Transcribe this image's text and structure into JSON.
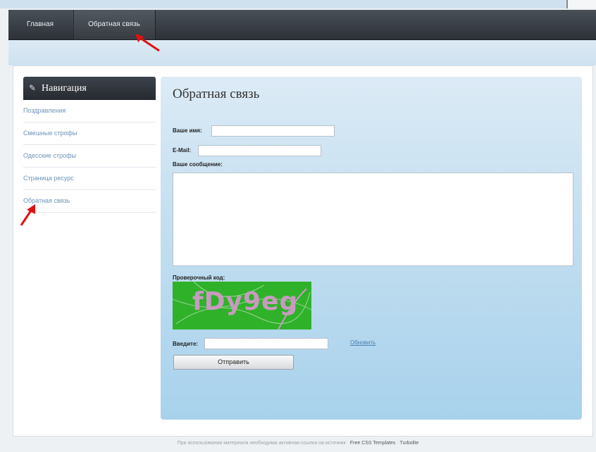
{
  "nav": {
    "home": "Главная",
    "feedback": "Обратная связь"
  },
  "sidebar": {
    "title": "Навигация",
    "icon": "wrench-icon",
    "items": [
      {
        "label": "Поздравления"
      },
      {
        "label": "Смешные стрoфы"
      },
      {
        "label": "Одесские строфы"
      },
      {
        "label": "Страница ресурс"
      },
      {
        "label": "Обратная связь"
      }
    ]
  },
  "form": {
    "heading": "Обратная связь",
    "name_label": "Ваше имя:",
    "name_value": "",
    "email_label": "E-Mail:",
    "email_value": "",
    "message_label": "Ваше сообщение:",
    "message_value": "",
    "captcha_label": "Проверочный код:",
    "captcha_text": "fDy9eg",
    "enter_label": "Введите:",
    "enter_value": "",
    "refresh_link": "Обновить",
    "submit_label": "Отправить"
  },
  "footer": {
    "text": "При использовании материала необходима активная ссылка на источник ·",
    "link1": "Free CSS Templates",
    "link2": "Turbolite"
  },
  "colors": {
    "navbar": "#2c3138",
    "content_bg": "#a8d2ec",
    "sidebar_link": "#6d93b8",
    "captcha_bg": "#2fb22a",
    "arrow": "#e01010"
  }
}
